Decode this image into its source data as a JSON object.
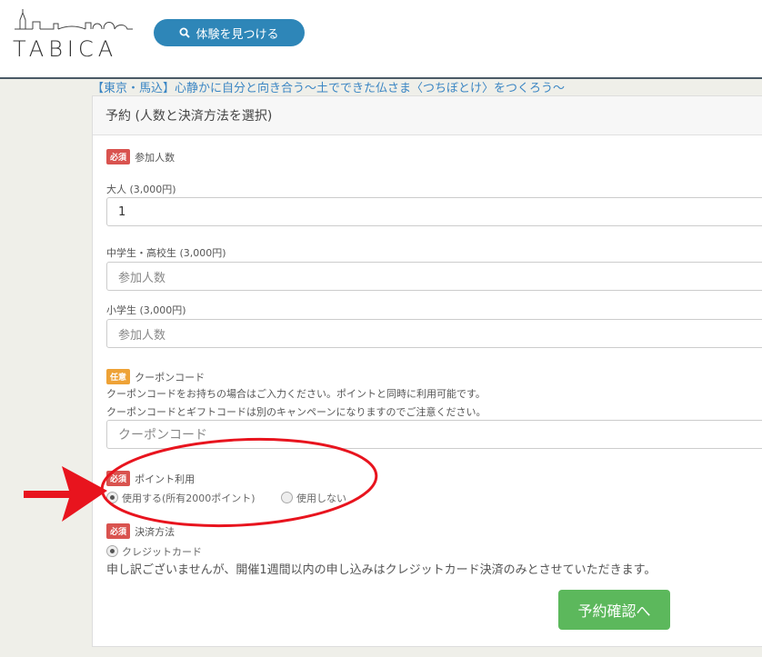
{
  "header": {
    "logo_text": "TABICA",
    "search_button_label": "体験を見つける"
  },
  "page_title": "【東京・馬込】心静かに自分と向き合う～土でできた仏さま〈つちぼとけ〉をつくろう～",
  "form": {
    "heading": "予約 (人数と決済方法を選択)",
    "participants": {
      "badge": "必須",
      "label": "参加人数",
      "adult_label": "大人 (3,000円)",
      "adult_value": "1",
      "student_label": "中学生・高校生 (3,000円)",
      "student_placeholder": "参加人数",
      "child_label": "小学生 (3,000円)",
      "child_placeholder": "参加人数"
    },
    "coupon": {
      "badge": "任意",
      "label": "クーポンコード",
      "help_1": "クーポンコードをお持ちの場合はご入力ください。ポイントと同時に利用可能です。",
      "help_2": "クーポンコードとギフトコードは別のキャンペーンになりますのでご注意ください。",
      "placeholder": "クーポンコード"
    },
    "points": {
      "badge": "必須",
      "label": "ポイント利用",
      "use_label": "使用する(所有2000ポイント)",
      "no_use_label": "使用しない",
      "selected": "use"
    },
    "payment": {
      "badge": "必須",
      "label": "決済方法",
      "credit_label": "クレジットカード",
      "selected": "credit"
    },
    "notice": "申し訳ございませんが、開催1週間以内の申し込みはクレジットカード決済のみとさせていただきます。",
    "confirm_button": "予約確認へ"
  },
  "colors": {
    "brand_blue": "#2e86b8",
    "title_blue": "#3b86c4",
    "required_red": "#d9534f",
    "optional_orange": "#eea236",
    "confirm_green": "#5cb85c",
    "annotation_red": "#e8141e"
  },
  "icons": [
    "search-icon"
  ]
}
